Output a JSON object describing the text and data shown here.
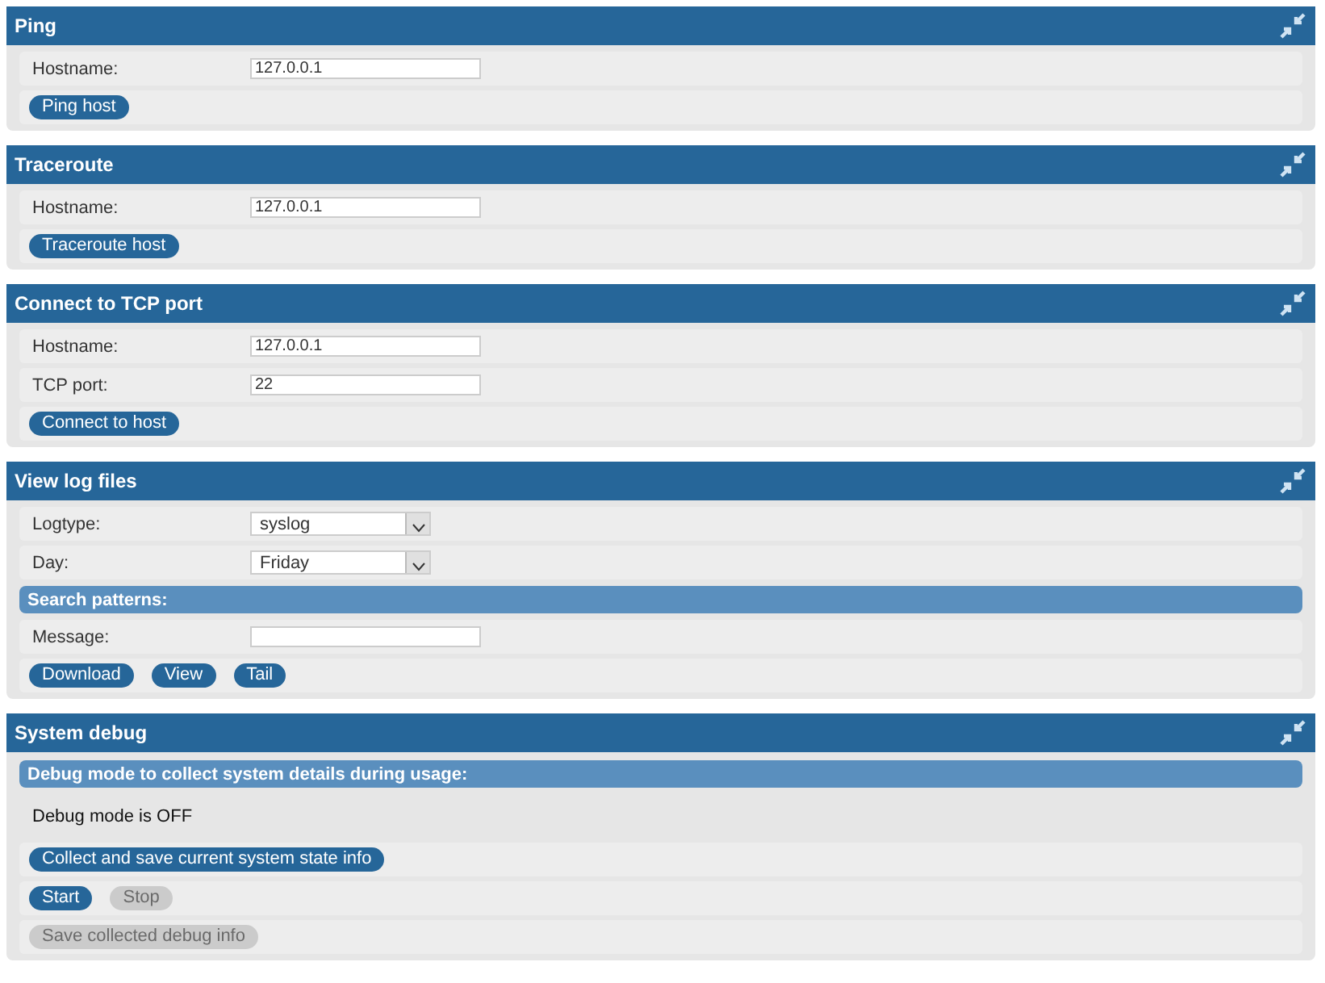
{
  "panels": [
    {
      "title": "Ping",
      "rows": [
        {
          "kind": "field",
          "label": "Hostname:",
          "value": "127.0.0.1"
        },
        {
          "kind": "buttons",
          "buttons": [
            {
              "label": "Ping host",
              "disabled": false
            }
          ]
        }
      ]
    },
    {
      "title": "Traceroute",
      "rows": [
        {
          "kind": "field",
          "label": "Hostname:",
          "value": "127.0.0.1"
        },
        {
          "kind": "buttons",
          "buttons": [
            {
              "label": "Traceroute host",
              "disabled": false
            }
          ]
        }
      ]
    },
    {
      "title": "Connect to TCP port",
      "rows": [
        {
          "kind": "field",
          "label": "Hostname:",
          "value": "127.0.0.1"
        },
        {
          "kind": "field",
          "label": "TCP port:",
          "value": "22"
        },
        {
          "kind": "buttons",
          "buttons": [
            {
              "label": "Connect to host",
              "disabled": false
            }
          ]
        }
      ]
    },
    {
      "title": "View log files",
      "rows": [
        {
          "kind": "select",
          "label": "Logtype:",
          "value": "syslog"
        },
        {
          "kind": "select",
          "label": "Day:",
          "value": "Friday"
        },
        {
          "kind": "subheader",
          "text": "Search patterns:"
        },
        {
          "kind": "field",
          "label": "Message:"
        },
        {
          "kind": "buttons",
          "buttons": [
            {
              "label": "Download",
              "disabled": false
            },
            {
              "label": "View",
              "disabled": false
            },
            {
              "label": "Tail",
              "disabled": false
            }
          ]
        }
      ]
    },
    {
      "title": "System debug",
      "rows": [
        {
          "kind": "subheader",
          "text": "Debug mode to collect system details during usage:"
        },
        {
          "kind": "text",
          "text": "Debug mode is OFF"
        },
        {
          "kind": "buttons",
          "buttons": [
            {
              "label": "Collect and save current system state info",
              "disabled": false
            }
          ]
        },
        {
          "kind": "buttons",
          "buttons": [
            {
              "label": "Start",
              "disabled": false
            },
            {
              "label": "Stop",
              "disabled": true
            }
          ]
        },
        {
          "kind": "buttons",
          "buttons": [
            {
              "label": "Save collected debug info",
              "disabled": true
            }
          ]
        }
      ]
    }
  ]
}
